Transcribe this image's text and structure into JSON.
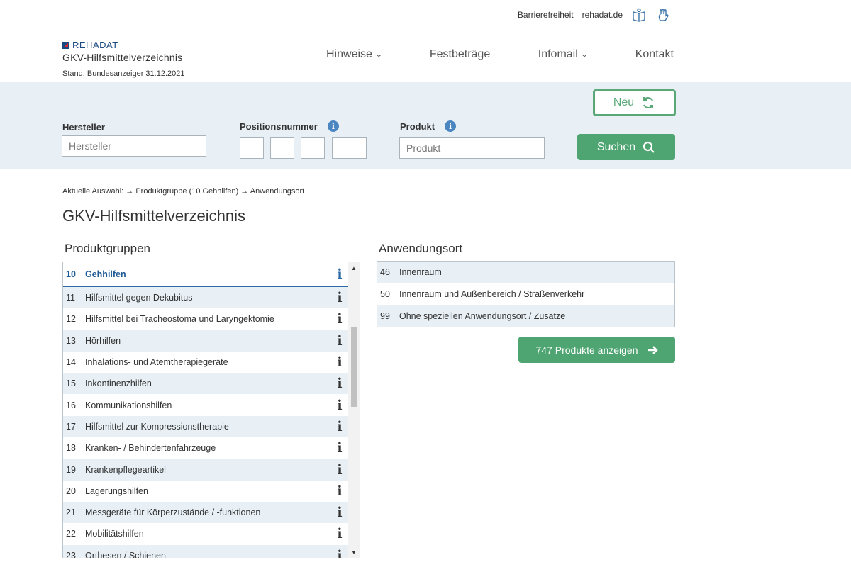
{
  "topbar": {
    "accessibility_label": "Barrierefreiheit",
    "site_link": "rehadat.de",
    "icons": [
      "easy-language-icon",
      "sign-language-icon"
    ]
  },
  "brand": {
    "logo_text": "REHADAT",
    "title": "GKV-Hilfsmittelverzeichnis",
    "stand": "Stand: Bundesanzeiger 31.12.2021"
  },
  "nav": {
    "items": [
      {
        "label": "Hinweise",
        "dropdown": true
      },
      {
        "label": "Festbeträge",
        "dropdown": false
      },
      {
        "label": "Infomail",
        "dropdown": true
      },
      {
        "label": "Kontakt",
        "dropdown": false
      }
    ]
  },
  "search": {
    "hersteller_label": "Hersteller",
    "hersteller_placeholder": "Hersteller",
    "position_label": "Positionsnummer",
    "produkt_label": "Produkt",
    "produkt_placeholder": "Produkt",
    "neu_label": "Neu",
    "suchen_label": "Suchen"
  },
  "breadcrumb": "Aktuelle Auswahl: → Produktgruppe (10 Gehhilfen) → Anwendungsort",
  "page_title": "GKV-Hilfsmittelverzeichnis",
  "produktgruppen": {
    "title": "Produktgruppen",
    "items": [
      {
        "num": "10",
        "name": "Gehhilfen",
        "selected": true
      },
      {
        "num": "11",
        "name": "Hilfsmittel gegen Dekubitus"
      },
      {
        "num": "12",
        "name": "Hilfsmittel bei Tracheostoma und Laryngektomie"
      },
      {
        "num": "13",
        "name": "Hörhilfen"
      },
      {
        "num": "14",
        "name": "Inhalations- und Atemtherapiegeräte"
      },
      {
        "num": "15",
        "name": "Inkontinenzhilfen"
      },
      {
        "num": "16",
        "name": "Kommunikationshilfen"
      },
      {
        "num": "17",
        "name": "Hilfsmittel zur Kompressionstherapie"
      },
      {
        "num": "18",
        "name": "Kranken- / Behindertenfahrzeuge"
      },
      {
        "num": "19",
        "name": "Krankenpflegeartikel"
      },
      {
        "num": "20",
        "name": "Lagerungshilfen"
      },
      {
        "num": "21",
        "name": "Messgeräte für Körperzustände / -funktionen"
      },
      {
        "num": "22",
        "name": "Mobilitätshilfen"
      },
      {
        "num": "23",
        "name": "Orthesen / Schienen"
      }
    ],
    "info_glyph": "i"
  },
  "anwendungsort": {
    "title": "Anwendungsort",
    "items": [
      {
        "num": "46",
        "name": "Innenraum"
      },
      {
        "num": "50",
        "name": "Innenraum und Außenbereich / Straßenverkehr"
      },
      {
        "num": "99",
        "name": "Ohne speziellen Anwendungsort / Zusätze"
      }
    ]
  },
  "show_button": "747 Produkte anzeigen",
  "colors": {
    "accent_green": "#4ea572",
    "band_blue": "#e8f0f6",
    "link_blue": "#2d6aa5"
  }
}
